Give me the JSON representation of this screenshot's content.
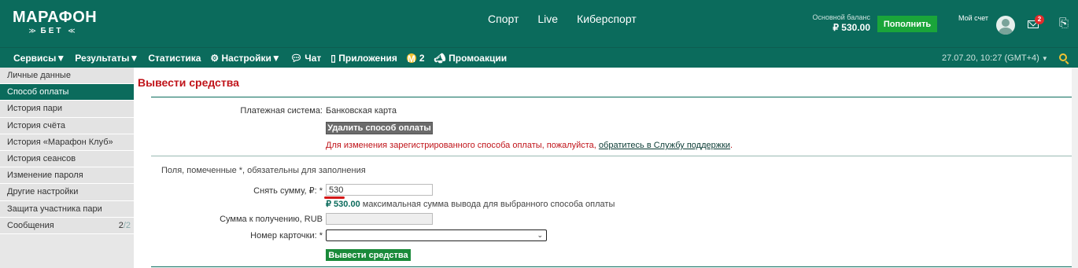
{
  "header": {
    "logo_main": "МАРАФОН",
    "logo_sub": "БЕТ",
    "nav": [
      "Спорт",
      "Live",
      "Киберспорт"
    ],
    "balance_label": "Основной баланс",
    "balance_value": "₽ 530.00",
    "topup_label": "Пополнить",
    "account_label": "Мой счет",
    "mail_badge": "2"
  },
  "subnav": {
    "services": "Сервисы",
    "results": "Результаты",
    "statistics": "Статистика",
    "settings": "Настройки",
    "chat": "Чат",
    "apps": "Приложения",
    "coins": "2",
    "promo": "Промоакции",
    "datetime": "27.07.20, 10:27 (GMT+4)"
  },
  "sidebar": {
    "items": [
      {
        "label": "Личные данные"
      },
      {
        "label": "Способ оплаты",
        "active": true
      },
      {
        "label": "История пари"
      },
      {
        "label": "История счёта"
      },
      {
        "label": "История «Марафон Клуб»"
      },
      {
        "label": "История сеансов"
      },
      {
        "label": "Изменение пароля"
      },
      {
        "label": "Другие настройки"
      },
      {
        "label": "Защита участника пари"
      },
      {
        "label": "Сообщения",
        "count": "2",
        "count_total": "2"
      }
    ]
  },
  "main": {
    "title": "Вывести средства",
    "payment_system_label": "Платежная система:",
    "payment_system_value": "Банковская карта",
    "delete_button": "Удалить способ оплаты",
    "notice_text": "Для изменения зарегистрированного способа оплаты, пожалуйста, ",
    "notice_link": "обратитесь в Службу поддержки",
    "notice_end": ".",
    "required_note": "Поля, помеченные *, обязательны для заполнения",
    "amount_label": "Снять сумму, ₽: *",
    "amount_value": "530",
    "max_amount": "₽ 530.00",
    "max_hint": " максимальная сумма вывода для выбранного способа оплаты",
    "receive_label": "Сумма к получению, RUB",
    "receive_value": "",
    "card_label": "Номер карточки: *",
    "card_value": "",
    "withdraw_button": "Вывести средства"
  },
  "colors": {
    "brand": "#0b6b5c",
    "accent_red": "#c0141a",
    "topup_green": "#1aa53a",
    "coin_yellow": "#f1c232"
  }
}
